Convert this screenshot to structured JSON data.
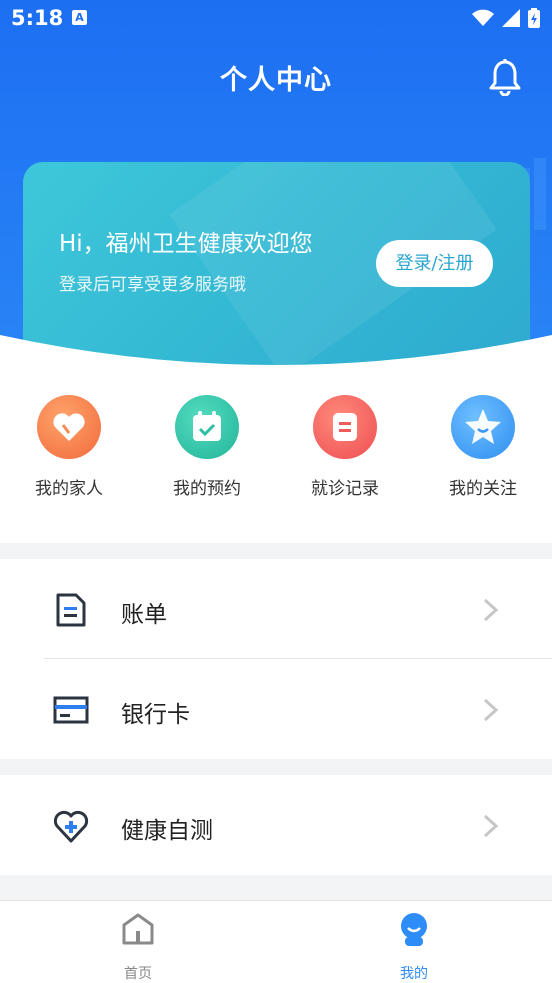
{
  "status": {
    "time": "5:18",
    "notif_letter": "A"
  },
  "header": {
    "title": "个人中心"
  },
  "card": {
    "greeting": "Hi，福州卫生健康欢迎您",
    "subtitle": "登录后可享受更多服务哦",
    "login_label": "登录/注册"
  },
  "quick_actions": [
    {
      "label": "我的家人",
      "icon": "heart-icon",
      "color": "#f57a4a"
    },
    {
      "label": "我的预约",
      "icon": "calendar-check-icon",
      "color": "#30c2a8"
    },
    {
      "label": "就诊记录",
      "icon": "record-icon",
      "color": "#f2595a"
    },
    {
      "label": "我的关注",
      "icon": "star-icon",
      "color": "#3d9ff2"
    }
  ],
  "menu": {
    "bill": "账单",
    "bank_card": "银行卡",
    "health_test": "健康自测"
  },
  "tabs": [
    {
      "label": "首页",
      "active": false
    },
    {
      "label": "我的",
      "active": true
    }
  ],
  "colors": {
    "primary": "#1d6ff2",
    "accent": "#2e8cf6",
    "tab_inactive": "#888888"
  }
}
